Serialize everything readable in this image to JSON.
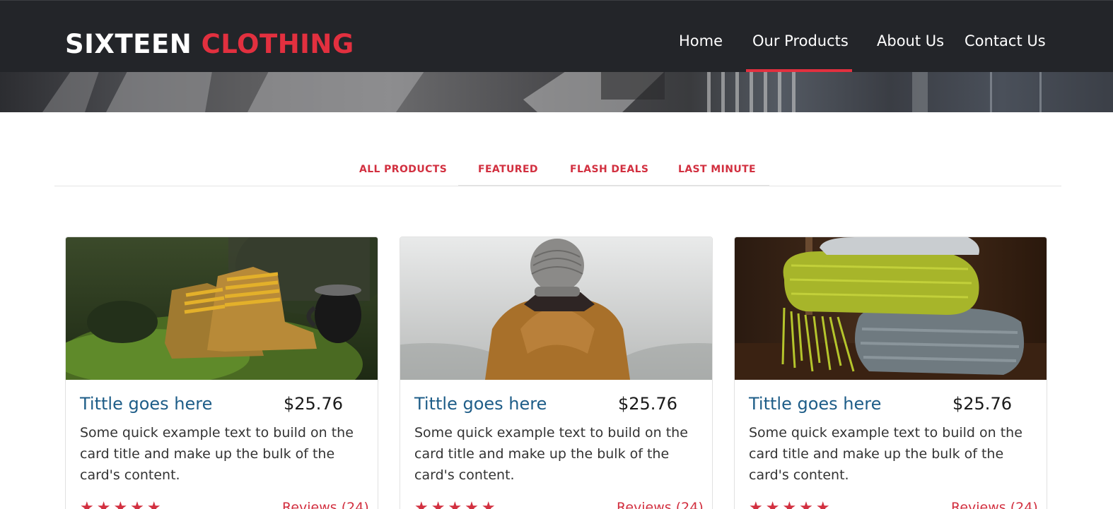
{
  "header": {
    "brand_white": "SIXTEEN",
    "brand_red": "CLOTHING",
    "nav": [
      {
        "label": "Home",
        "active": false
      },
      {
        "label": "Our Products",
        "active": true
      },
      {
        "label": "About Us",
        "active": false
      },
      {
        "label": "Contact Us",
        "active": false
      }
    ]
  },
  "filters": [
    {
      "label": "ALL PRODUCTS"
    },
    {
      "label": "FEATURED"
    },
    {
      "label": "FLASH DEALS"
    },
    {
      "label": "LAST MINUTE"
    }
  ],
  "products": [
    {
      "title": "Tittle goes here",
      "price": "$25.76",
      "text": "Some quick example text to build on the card title and make up the bulk of the card's content.",
      "stars": "★★★★★",
      "reviews": "Reviews (24)"
    },
    {
      "title": "Tittle goes here",
      "price": "$25.76",
      "text": "Some quick example text to build on the card title and make up the bulk of the card's content.",
      "stars": "★★★★★",
      "reviews": "Reviews (24)"
    },
    {
      "title": "Tittle goes here",
      "price": "$25.76",
      "text": "Some quick example text to build on the card title and make up the bulk of the card's content.",
      "stars": "★★★★★",
      "reviews": "Reviews (24)"
    }
  ],
  "colors": {
    "header_bg": "#232529",
    "accent": "#e2303f",
    "title_blue": "#1e5d88"
  }
}
